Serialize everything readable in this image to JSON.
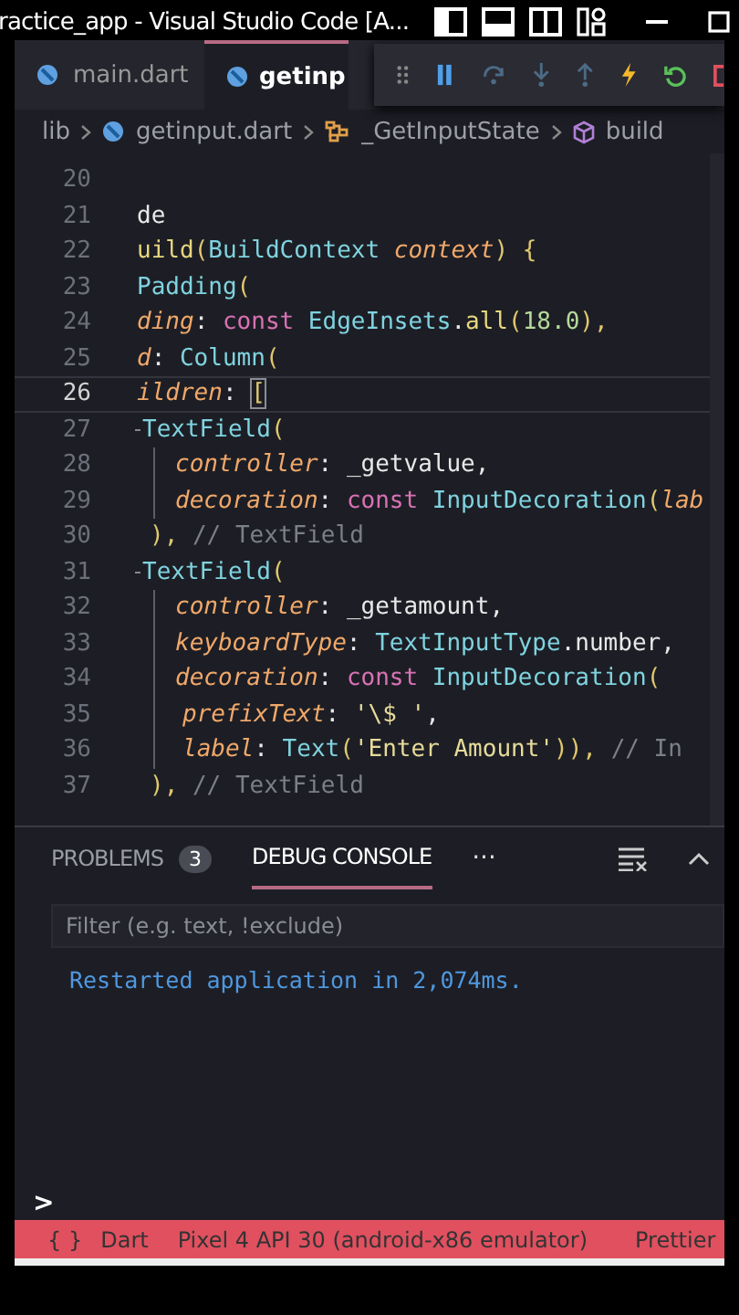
{
  "window": {
    "title": "ractice_app - Visual Studio Code [A..."
  },
  "tabs": [
    {
      "label": "main.dart",
      "selected": false
    },
    {
      "label": "getinp",
      "selected": true
    }
  ],
  "breadcrumb": [
    {
      "label": "lib",
      "kind": "folder"
    },
    {
      "label": "getinput.dart",
      "kind": "file"
    },
    {
      "label": "_GetInputState",
      "kind": "class"
    },
    {
      "label": "build",
      "kind": "method"
    }
  ],
  "editor": {
    "lines": [
      {
        "number": "20",
        "kind": "top",
        "current": false
      },
      {
        "number": "21",
        "kind": "top",
        "current": false,
        "tokens": [
          {
            "text": "de",
            "kind": "plain"
          }
        ]
      },
      {
        "number": "22",
        "kind": "top",
        "current": false,
        "tokens": [
          {
            "text": "uild",
            "kind": "func"
          },
          {
            "text": "(",
            "kind": "punct"
          },
          {
            "text": "BuildContext",
            "kind": "type"
          },
          {
            "text": " context",
            "kind": "param"
          },
          {
            "text": ") {",
            "kind": "punct"
          }
        ]
      },
      {
        "number": "23",
        "kind": "top",
        "current": false,
        "tokens": [
          {
            "text": " Padding",
            "kind": "type"
          },
          {
            "text": "(",
            "kind": "punct"
          }
        ]
      },
      {
        "number": "24",
        "kind": "top",
        "current": false,
        "tokens": [
          {
            "text": "ding",
            "kind": "param"
          },
          {
            "text": ": ",
            "kind": "plain"
          },
          {
            "text": "const",
            "kind": "keyword"
          },
          {
            "text": " EdgeInsets",
            "kind": "type"
          },
          {
            "text": ".",
            "kind": "plain"
          },
          {
            "text": "all",
            "kind": "func"
          },
          {
            "text": "(",
            "kind": "punct"
          },
          {
            "text": "18.0",
            "kind": "number"
          },
          {
            "text": "),",
            "kind": "punct"
          }
        ]
      },
      {
        "number": "25",
        "kind": "top",
        "current": false,
        "tokens": [
          {
            "text": "d",
            "kind": "param"
          },
          {
            "text": ": ",
            "kind": "plain"
          },
          {
            "text": "Column",
            "kind": "type"
          },
          {
            "text": "(",
            "kind": "punct"
          }
        ]
      },
      {
        "number": "26",
        "kind": "top",
        "current": true,
        "tokens": [
          {
            "text": "ildren",
            "kind": "param"
          },
          {
            "text": ": ",
            "kind": "plain"
          },
          {
            "text": "[",
            "kind": "bracket"
          }
        ]
      },
      {
        "number": "27",
        "kind": "field",
        "current": false,
        "tokens": [
          {
            "text": "TextField",
            "kind": "type"
          },
          {
            "text": "(",
            "kind": "punct"
          }
        ]
      },
      {
        "number": "28",
        "kind": "inner",
        "current": false,
        "tokens": [
          {
            "text": "controller",
            "kind": "param"
          },
          {
            "text": ": ",
            "kind": "plain"
          },
          {
            "text": "_getvalue,",
            "kind": "plain"
          }
        ]
      },
      {
        "number": "29",
        "kind": "inner",
        "current": false,
        "tokens": [
          {
            "text": "decoration",
            "kind": "param"
          },
          {
            "text": ": ",
            "kind": "plain"
          },
          {
            "text": "const",
            "kind": "keyword"
          },
          {
            "text": " InputDecoration",
            "kind": "type"
          },
          {
            "text": "(",
            "kind": "punct"
          },
          {
            "text": "lab",
            "kind": "param"
          }
        ]
      },
      {
        "number": "30",
        "kind": "close",
        "current": false,
        "tokens": [
          {
            "text": "), ",
            "kind": "punct"
          },
          {
            "text": "// TextField",
            "kind": "comment"
          }
        ]
      },
      {
        "number": "31",
        "kind": "field",
        "current": false,
        "tokens": [
          {
            "text": "TextField",
            "kind": "type"
          },
          {
            "text": "(",
            "kind": "punct"
          }
        ]
      },
      {
        "number": "32",
        "kind": "inner",
        "current": false,
        "tokens": [
          {
            "text": "controller",
            "kind": "param"
          },
          {
            "text": ": ",
            "kind": "plain"
          },
          {
            "text": "_getamount,",
            "kind": "plain"
          }
        ]
      },
      {
        "number": "33",
        "kind": "inner",
        "current": false,
        "tokens": [
          {
            "text": "keyboardType",
            "kind": "param"
          },
          {
            "text": ": ",
            "kind": "plain"
          },
          {
            "text": "TextInputType",
            "kind": "type"
          },
          {
            "text": ".number,",
            "kind": "plain"
          }
        ]
      },
      {
        "number": "34",
        "kind": "inner",
        "current": false,
        "tokens": [
          {
            "text": "decoration",
            "kind": "param"
          },
          {
            "text": ": ",
            "kind": "plain"
          },
          {
            "text": "const",
            "kind": "keyword"
          },
          {
            "text": " InputDecoration",
            "kind": "type"
          },
          {
            "text": "(",
            "kind": "punct"
          }
        ]
      },
      {
        "number": "35",
        "kind": "deep",
        "current": false,
        "tokens": [
          {
            "text": "prefixText",
            "kind": "param"
          },
          {
            "text": ": ",
            "kind": "plain"
          },
          {
            "text": "'\\$ '",
            "kind": "string"
          },
          {
            "text": ",",
            "kind": "plain"
          }
        ]
      },
      {
        "number": "36",
        "kind": "deep",
        "current": false,
        "tokens": [
          {
            "text": "label",
            "kind": "param"
          },
          {
            "text": ": ",
            "kind": "plain"
          },
          {
            "text": "Text",
            "kind": "type"
          },
          {
            "text": "(",
            "kind": "punct"
          },
          {
            "text": "'Enter Amount'",
            "kind": "string"
          },
          {
            "text": ")), ",
            "kind": "punct"
          },
          {
            "text": "// In",
            "kind": "comment"
          }
        ]
      },
      {
        "number": "37",
        "kind": "close",
        "current": false,
        "tokens": [
          {
            "text": "), ",
            "kind": "punct"
          },
          {
            "text": "// TextField",
            "kind": "comment"
          }
        ]
      }
    ]
  },
  "panel": {
    "tabs": [
      {
        "label": "PROBLEMS",
        "badge": "3",
        "selected": false
      },
      {
        "label": "DEBUG CONSOLE",
        "selected": true
      }
    ],
    "more": "···",
    "filter": {
      "placeholder": "Filter (e.g. text, !exclude)"
    },
    "output": [
      "Restarted application in 2,074ms."
    ],
    "prompt": ">"
  },
  "status_bar": {
    "braces": "{ }",
    "language": "Dart",
    "device": "Pixel 4 API 30 (android-x86 emulator)",
    "formatter": "Prettier"
  }
}
